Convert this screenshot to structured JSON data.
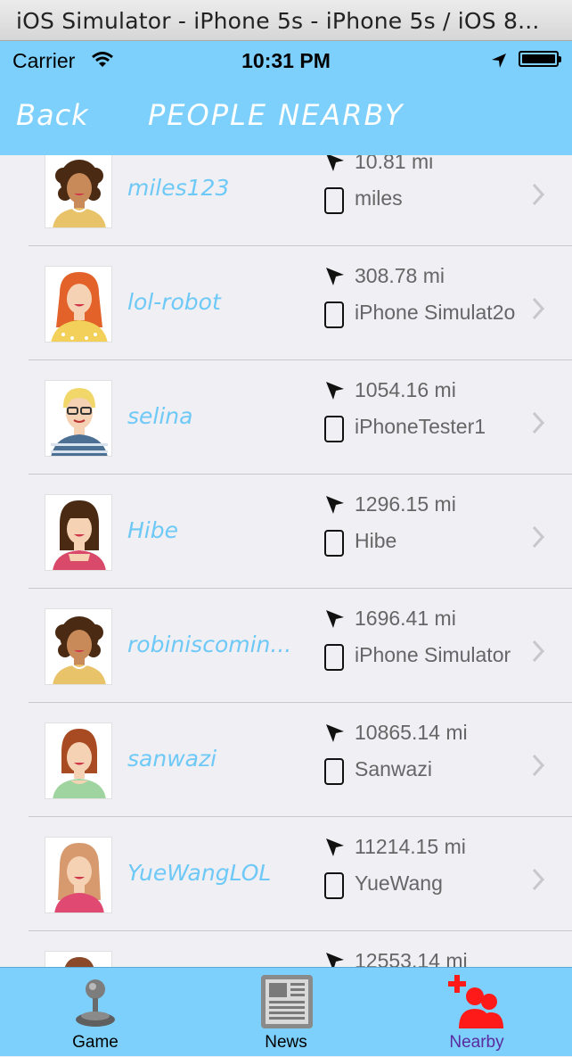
{
  "window": {
    "title": "iOS Simulator - iPhone 5s - iPhone 5s / iOS 8..."
  },
  "status_bar": {
    "carrier": "Carrier",
    "time": "10:31 PM"
  },
  "nav": {
    "back_label": "Back",
    "title": "PEOPLE NEARBY"
  },
  "people": [
    {
      "username": "miles123",
      "distance": "10.81 mi",
      "device": "miles"
    },
    {
      "username": "lol-robot",
      "distance": "308.78 mi",
      "device": "iPhone Simulat2o"
    },
    {
      "username": "selina",
      "distance": "1054.16 mi",
      "device": "iPhoneTester1"
    },
    {
      "username": "Hibe",
      "distance": "1296.15 mi",
      "device": "Hibe"
    },
    {
      "username": "robiniscomin...",
      "distance": "1696.41 mi",
      "device": "iPhone Simulator"
    },
    {
      "username": "sanwazi",
      "distance": "10865.14 mi",
      "device": "Sanwazi"
    },
    {
      "username": "YueWangLOL",
      "distance": "11214.15 mi",
      "device": "YueWang"
    },
    {
      "username": "",
      "distance": "12553.14 mi",
      "device": ""
    }
  ],
  "tabs": [
    {
      "label": "Game",
      "icon": "joystick-icon",
      "active": false
    },
    {
      "label": "News",
      "icon": "newspaper-icon",
      "active": false
    },
    {
      "label": "Nearby",
      "icon": "people-add-icon",
      "active": true
    }
  ],
  "colors": {
    "header": "#7dd0fb",
    "username": "#6ec9f7",
    "active_tab": "#5b2a9e",
    "nearby_icon": "#ff1a1a"
  }
}
